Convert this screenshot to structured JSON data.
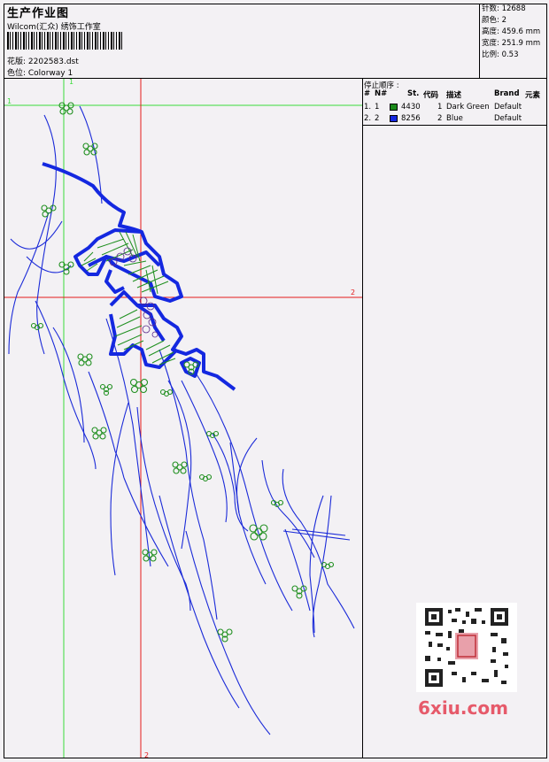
{
  "header": {
    "title": "生产作业图",
    "company": "Wilcom(汇众) 绣饰工作室",
    "design_line": "花版: 2202583.dst",
    "colorway_line": "色位: Colorway 1"
  },
  "stats": [
    "针数: 12688",
    "颜色: 2",
    "高度: 459.6 mm",
    "宽度: 251.9 mm",
    "比例: 0.53"
  ],
  "stop_sequence": {
    "title": "停止顺序 :",
    "headers": [
      "#",
      "N#",
      "St.",
      "代码",
      "描述",
      "Brand",
      "元素"
    ],
    "rows": [
      {
        "index": "1.",
        "n": "1",
        "code": "4430",
        "needle": "1",
        "desc": "Dark Green",
        "brand": "Default",
        "swatch": "#1a8a1a"
      },
      {
        "index": "2.",
        "n": "2",
        "code": "8256",
        "needle": "2",
        "desc": "Blue",
        "brand": "Default",
        "swatch": "#1428e0"
      }
    ]
  },
  "guides": {
    "label_v1": "1",
    "label_h1": "1",
    "label_h2": "2",
    "label_v2": "2"
  },
  "colors": {
    "green_guide": "#3adb3a",
    "red_guide": "#e41a1a",
    "thread_blue": "#1a2ad8",
    "thread_green": "#1f8f1f"
  },
  "watermark": {
    "text": "6xiu.com",
    "qr_label": "qr-code-icon"
  }
}
